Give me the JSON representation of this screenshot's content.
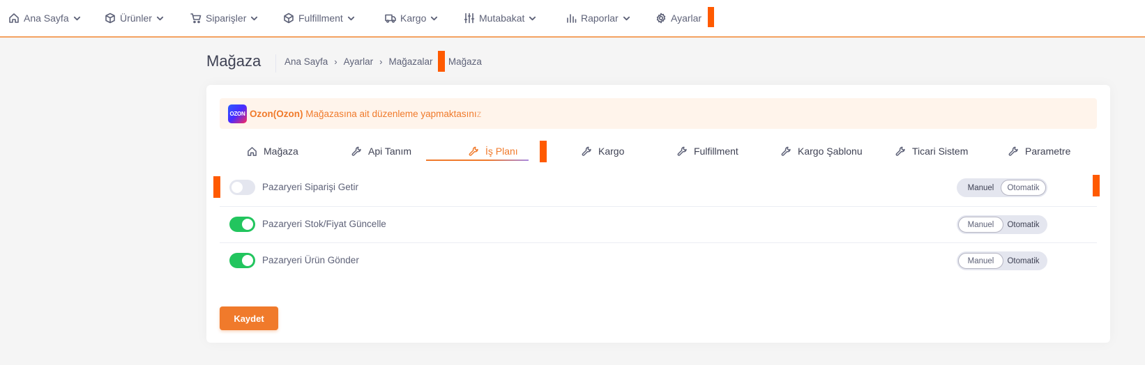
{
  "nav": {
    "items": [
      {
        "label": "Ana Sayfa",
        "icon": "home-icon"
      },
      {
        "label": "Ürünler",
        "icon": "box-icon"
      },
      {
        "label": "Siparişler",
        "icon": "cart-icon"
      },
      {
        "label": "Fulfillment",
        "icon": "cube-icon"
      },
      {
        "label": "Kargo",
        "icon": "truck-icon"
      },
      {
        "label": "Mutabakat",
        "icon": "sliders-icon"
      },
      {
        "label": "Raporlar",
        "icon": "bar-chart-icon"
      },
      {
        "label": "Ayarlar",
        "icon": "gear-icon"
      }
    ]
  },
  "page": {
    "title": "Mağaza",
    "breadcrumb": [
      "Ana Sayfa",
      "Ayarlar",
      "Mağazalar",
      "Mağaza"
    ]
  },
  "notice": {
    "logo_text": "OZON",
    "store": "Ozon(Ozon)",
    "text": "Mağazasına ait düzenleme yapmaktasını",
    "text_fade": "z"
  },
  "tabs": [
    {
      "label": "Mağaza",
      "icon": "home-icon",
      "active": false
    },
    {
      "label": "Api Tanım",
      "icon": "wrench-icon",
      "active": false
    },
    {
      "label": "İş Planı",
      "icon": "wrench-icon",
      "active": true
    },
    {
      "label": "Kargo",
      "icon": "wrench-icon",
      "active": false
    },
    {
      "label": "Fulfillment",
      "icon": "wrench-icon",
      "active": false
    },
    {
      "label": "Kargo Şablonu",
      "icon": "wrench-icon",
      "active": false
    },
    {
      "label": "Ticari Sistem",
      "icon": "wrench-icon",
      "active": false
    },
    {
      "label": "Parametre",
      "icon": "wrench-icon",
      "active": false
    }
  ],
  "rows": [
    {
      "label": "Pazaryeri Siparişi Getir",
      "enabled": false,
      "mode": "Otomatik"
    },
    {
      "label": "Pazaryeri Stok/Fiyat Güncelle",
      "enabled": true,
      "mode": "Manuel"
    },
    {
      "label": "Pazaryeri Ürün Gönder",
      "enabled": true,
      "mode": "Manuel"
    }
  ],
  "mode_options": {
    "manual": "Manuel",
    "auto": "Otomatik"
  },
  "save_label": "Kaydet",
  "colors": {
    "accent": "#f07a2b",
    "switch_on": "#22c55e",
    "marker": "#ff5a00",
    "notice_bg": "#fff4eb"
  }
}
